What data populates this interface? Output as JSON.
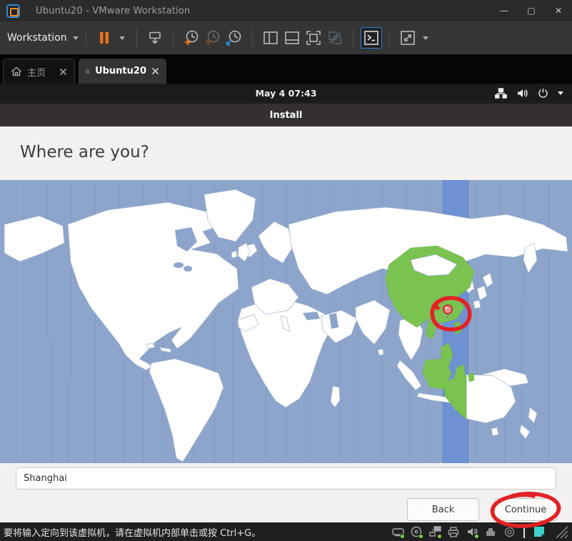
{
  "window": {
    "title": "Ubuntu20 - VMware Workstation",
    "controls": {
      "minimize": "—",
      "maximize": "▢",
      "close": "✕"
    }
  },
  "toolbar": {
    "menu_label": "Workstation",
    "icons": [
      "pause-power-icon",
      "grab-input-icon",
      "take-snapshot-icon",
      "revert-snapshot-icon",
      "snapshot-manager-icon",
      "show-library-icon",
      "show-thumbnails-icon",
      "fullscreen-icon",
      "unity-mode-icon",
      "console-view-icon",
      "fit-guest-icon"
    ]
  },
  "tabs": [
    {
      "label": "主页",
      "icon": "home-icon"
    },
    {
      "label": "Ubuntu20",
      "icon": "vm-running-icon",
      "active": true
    }
  ],
  "vm": {
    "clock": "May 4  07:43",
    "panel_icons": [
      "network-icon",
      "volume-icon",
      "power-icon",
      "chevron-down-icon"
    ],
    "installer": {
      "window_title": "Install",
      "heading": "Where are you?",
      "timezone_value": "Shanghai",
      "back_label": "Back",
      "continue_label": "Continue",
      "map": {
        "highlighted_region_color": "#7ac351",
        "selected_band_color": "#6e91d4",
        "ocean_color": "#8da5cb",
        "pin_city": "Shanghai"
      }
    }
  },
  "statusbar": {
    "message": "要将输入定向到该虚拟机，请在虚拟机内部单击或按 Ctrl+G。",
    "icons": [
      "harddisk-icon",
      "cdrom-icon",
      "network-adapter-icon",
      "printer-icon",
      "sound-icon",
      "usb-device-icon",
      "dial-icon",
      "message-log-icon"
    ]
  },
  "annotations": {
    "color": "#e32124",
    "items": [
      "hand-drawn circle around Shanghai pin on map",
      "hand-drawn circle around Continue button"
    ]
  }
}
